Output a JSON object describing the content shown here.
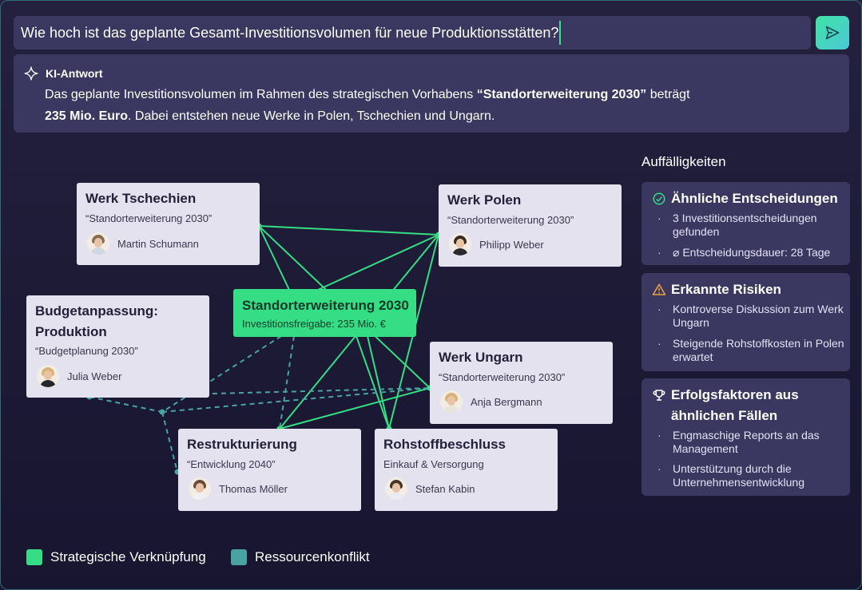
{
  "query": {
    "text": "Wie hoch ist das geplante Gesamt-Investitionsvolumen für neue Produktionsstätten?",
    "send_icon": "send-icon"
  },
  "answer": {
    "label": "KI-Antwort",
    "icon": "sparkle-icon",
    "line1_pre": "Das geplante Investitionsvolumen im Rahmen des strategischen Vorhabens ",
    "line1_bold": "“Standorterweiterung 2030”",
    "line1_post": " beträgt",
    "line2_bold": "235 Mio. Euro",
    "line2_post": ". Dabei entstehen neue Werke in Polen, Tschechien und Ungarn."
  },
  "graph": {
    "center": {
      "title": "Standorterweiterung 2030",
      "subtitle": "Investitionsfreigabe: 235 Mio. €"
    },
    "nodes": {
      "tschechien": {
        "title": "Werk Tschechien",
        "subtitle": "“Standorterweiterung 2030”",
        "person": "Martin Schumann"
      },
      "polen": {
        "title": "Werk Polen",
        "subtitle": "“Standorterweiterung 2030”",
        "person": "Philipp Weber"
      },
      "budget": {
        "title_line1": "Budgetanpassung:",
        "title_line2": "Produktion",
        "subtitle": "“Budgetplanung 2030”",
        "person": "Julia Weber"
      },
      "ungarn": {
        "title": "Werk Ungarn",
        "subtitle": "“Standorterweiterung 2030”",
        "person": "Anja Bergmann"
      },
      "restrukt": {
        "title": "Restrukturierung",
        "subtitle": "“Entwicklung 2040”",
        "person": "Thomas Möller"
      },
      "rohstoff": {
        "title": "Rohstoffbeschluss",
        "subtitle": "Einkauf & Versorgung",
        "person": "Stefan Kabin"
      }
    }
  },
  "side": {
    "title": "Auffälligkeiten",
    "cards": [
      {
        "title": "Ähnliche Entscheidungen",
        "icon": "check-circle-icon",
        "bullets": [
          "3 Investitionsentscheidungen gefunden",
          "⌀ Entscheidungsdauer: 28 Tage"
        ]
      },
      {
        "title": "Erkannte Risiken",
        "icon": "warning-icon",
        "bullets": [
          "Kontroverse Diskussion zum Werk Ungarn",
          "Steigende Rohstoffkosten in Polen erwartet"
        ]
      },
      {
        "title_line1": "Erfolgsfaktoren aus",
        "title_line2": "ähnlichen Fällen",
        "icon": "trophy-icon",
        "bullets": [
          "Engmaschige Reports an das Management",
          "Unterstützung durch die Unternehmensentwicklung"
        ]
      }
    ]
  },
  "legend": [
    {
      "label": "Strategische Verknüpfung",
      "color": "#35dd85"
    },
    {
      "label": "Ressourcenkonflikt",
      "color": "#4aa3a3"
    }
  ],
  "colors": {
    "strategic": "#35dd85",
    "conflict": "#4aa3a3",
    "panel": "#3a3760",
    "node": "#e4e2ee"
  }
}
